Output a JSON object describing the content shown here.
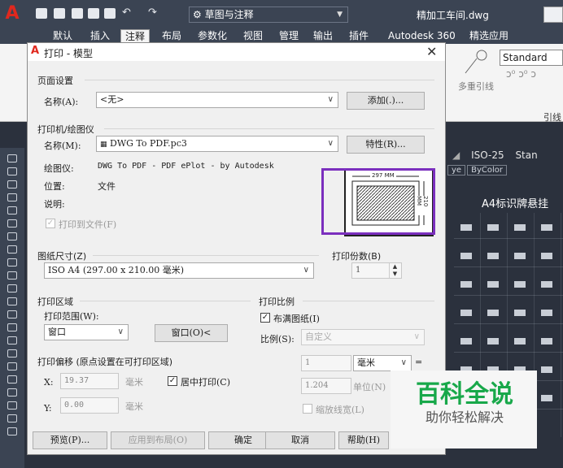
{
  "titlebar": {
    "workspace": "草图与注释",
    "file_name": "精加工车间.dwg"
  },
  "menu_tabs": [
    "默认",
    "插入",
    "注释",
    "布局",
    "参数化",
    "视图",
    "管理",
    "输出",
    "插件",
    "Autodesk 360",
    "精选应用"
  ],
  "ribbon": {
    "text_style": "Standard",
    "multileader_label": "多重引线",
    "leader_panel_label": "引线"
  },
  "drawing": {
    "dim_style": "ISO-25",
    "style_fragment": "Stan",
    "line_fragment": "ye",
    "bycolor": "ByColor",
    "label": "A4标识牌悬挂"
  },
  "dialog": {
    "title": "打印 - 模型",
    "page_setup": {
      "section": "页面设置",
      "name_label": "名称(A):",
      "name_value": "<无>",
      "add_button": "添加(.)..."
    },
    "printer": {
      "section": "打印机/绘图仪",
      "name_label": "名称(M):",
      "name_value": "DWG To PDF.pc3",
      "properties_button": "特性(R)...",
      "plotter_label": "绘图仪:",
      "plotter_value": "DWG To PDF - PDF ePlot - by Autodesk",
      "location_label": "位置:",
      "location_value": "文件",
      "description_label": "说明:",
      "print_to_file": "打印到文件(F)",
      "preview_width": "297 MM",
      "preview_height": "210 MM"
    },
    "paper_size": {
      "section": "图纸尺寸(Z)",
      "value": "ISO A4 (297.00 x 210.00 毫米)"
    },
    "copies": {
      "section": "打印份数(B)",
      "value": "1"
    },
    "plot_area": {
      "section": "打印区域",
      "range_label": "打印范围(W):",
      "range_value": "窗口",
      "window_button": "窗口(O)<"
    },
    "plot_scale": {
      "section": "打印比例",
      "fit_paper": "布满图纸(I)",
      "scale_label": "比例(S):",
      "scale_value": "自定义",
      "value1": "1",
      "unit1": "毫米",
      "equals": "=",
      "value2": "1.204",
      "unit2": "单位(N)",
      "scale_lineweights": "缩放线宽(L)"
    },
    "plot_offset": {
      "section": "打印偏移 (原点设置在可打印区域)",
      "x_label": "X:",
      "x_value": "19.37",
      "x_unit": "毫米",
      "y_label": "Y:",
      "y_value": "0.00",
      "y_unit": "毫米",
      "center_plot": "居中打印(C)"
    },
    "buttons": {
      "preview": "预览(P)...",
      "apply_layout": "应用到布局(O)",
      "ok": "确定",
      "cancel": "取消",
      "help": "帮助(H)"
    }
  },
  "watermark": {
    "line1": "百科全说",
    "line2": "助你轻松解决"
  },
  "colors": {
    "highlight_border": "#7b2fbe",
    "dark_chrome": "#3b4453",
    "watermark_green": "#18a84a"
  }
}
